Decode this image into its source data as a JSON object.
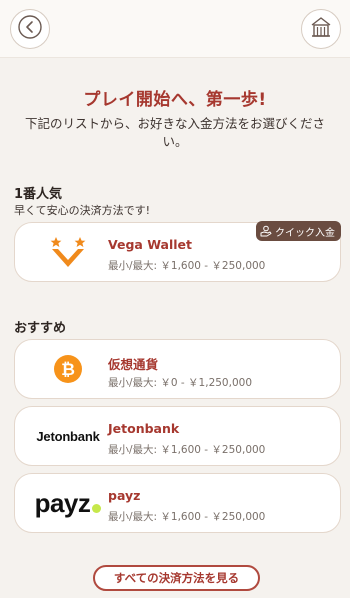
{
  "header": {
    "back_icon": "chevron-left-icon",
    "home_icon": "home-icon"
  },
  "hero": {
    "title": "プレイ開始へ、第一歩!",
    "subtitle": "下記のリストから、お好きな入金方法をお選びください。"
  },
  "popular": {
    "title": "1番人気",
    "subtitle": "早くて安心の決済方法です!",
    "items": [
      {
        "name": "Vega Wallet",
        "limit": "最小/最大: ￥1,600 - ￥250,000",
        "badge": "クイック入金",
        "icon": "vega-wallet-logo"
      }
    ]
  },
  "recommended": {
    "title": "おすすめ",
    "items": [
      {
        "name": "仮想通貨",
        "limit": "最小/最大: ￥0 - ￥1,250,000",
        "icon": "bitcoin-icon"
      },
      {
        "name": "Jetonbank",
        "limit": "最小/最大: ￥1,600 - ￥250,000",
        "icon": "jetonbank-logo",
        "logo_text": "Jetonbank"
      },
      {
        "name": "payz",
        "limit": "最小/最大: ￥1,600 - ￥250,000",
        "icon": "payz-logo",
        "logo_text": "payz"
      }
    ]
  },
  "footer": {
    "see_all_label": "すべての決済方法を見る"
  },
  "colors": {
    "accent": "#a6382f",
    "badge_bg": "#6a4c40",
    "bitcoin": "#f7931a",
    "vega": "#f08a1c",
    "payz_dot": "#c6e84a"
  }
}
